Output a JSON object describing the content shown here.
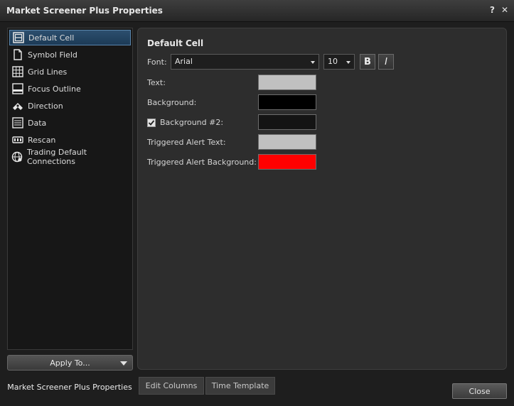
{
  "window": {
    "title": "Market Screener Plus Properties",
    "help_glyph": "?",
    "close_glyph": "✕"
  },
  "sidebar": {
    "items": [
      {
        "label": "Default Cell",
        "icon": "cell-grid-icon",
        "selected": true
      },
      {
        "label": "Symbol Field",
        "icon": "document-icon",
        "selected": false
      },
      {
        "label": "Grid Lines",
        "icon": "grid-icon",
        "selected": false
      },
      {
        "label": "Focus Outline",
        "icon": "outline-icon",
        "selected": false
      },
      {
        "label": "Direction",
        "icon": "direction-arrows-icon",
        "selected": false
      },
      {
        "label": "Data",
        "icon": "data-table-icon",
        "selected": false
      },
      {
        "label": "Rescan",
        "icon": "rescan-icon",
        "selected": false
      },
      {
        "label": "Trading Default Connections",
        "icon": "connection-globe-icon",
        "selected": false
      }
    ],
    "apply_label": "Apply To..."
  },
  "panel": {
    "title": "Default Cell",
    "font_label": "Font:",
    "font_value": "Arial",
    "size_value": "10",
    "bold_label": "B",
    "italic_label": "I",
    "rows": [
      {
        "label": "Text:",
        "color": "#c0c0c0"
      },
      {
        "label": "Background:",
        "color": "#000000"
      },
      {
        "label": "Background #2:",
        "color": "#141414",
        "checked": true
      },
      {
        "label": "Triggered Alert Text:",
        "color": "#c0c0c0"
      },
      {
        "label": "Triggered Alert Background:",
        "color": "#ff0000"
      }
    ]
  },
  "tabs": [
    {
      "label": "Market Screener Plus Properties",
      "active": true
    },
    {
      "label": "Edit Columns",
      "active": false
    },
    {
      "label": "Time Template",
      "active": false
    }
  ],
  "footer": {
    "close_label": "Close"
  }
}
